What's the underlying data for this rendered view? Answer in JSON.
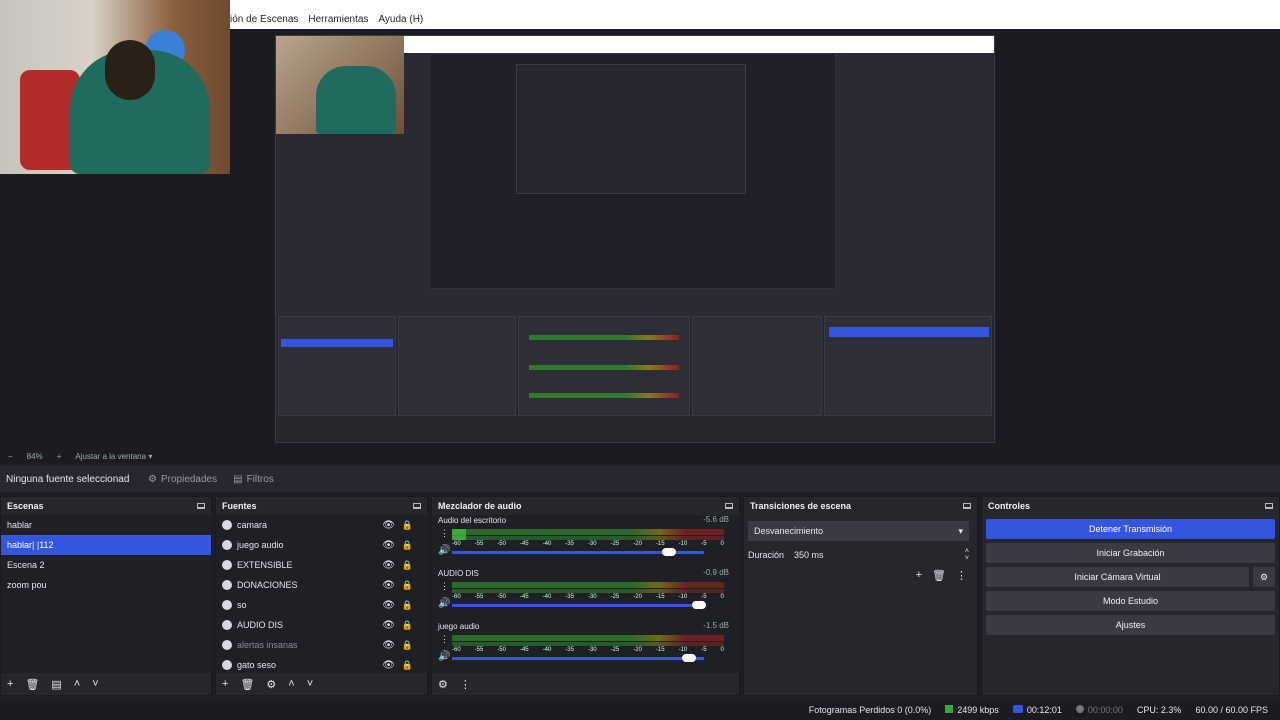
{
  "menu": {
    "item1": "ión de Escenas",
    "item2": "Herramientas",
    "item3": "Ayuda (H)"
  },
  "zoom": {
    "minus": "−",
    "value": "84%",
    "plus": "+",
    "fit": "Ajustar a la ventana"
  },
  "source_bar": {
    "none_selected": "Ninguna fuente seleccionad",
    "properties": "Propiedades",
    "filters": "Filtros"
  },
  "scenes": {
    "title": "Escenas",
    "items": [
      {
        "label": "hablar"
      },
      {
        "label": "hablar| |112"
      },
      {
        "label": "Escena 2"
      },
      {
        "label": "zoom pou"
      }
    ],
    "selected_index": 1
  },
  "sources": {
    "title": "Fuentes",
    "items": [
      {
        "label": "camara",
        "icon": "camera-icon"
      },
      {
        "label": "juego audio",
        "icon": "audio-icon"
      },
      {
        "label": "EXTENSIBLE",
        "icon": "browser-icon"
      },
      {
        "label": "DONACIONES",
        "icon": "browser-icon"
      },
      {
        "label": "so",
        "icon": "browser-icon"
      },
      {
        "label": "AUDIO DIS",
        "icon": "audio-icon"
      },
      {
        "label": "alertas insanas",
        "icon": "browser-icon"
      },
      {
        "label": "gato seso",
        "icon": "browser-icon"
      }
    ]
  },
  "mixer": {
    "title": "Mezclador de audio",
    "ticks": [
      "-60",
      "-55",
      "-50",
      "-45",
      "-40",
      "-35",
      "-30",
      "-25",
      "-20",
      "-15",
      "-10",
      "-5",
      "0"
    ],
    "channels": [
      {
        "name": "Audio del escritorio",
        "db": "-5.6 dB",
        "level": 0.05,
        "volume": 0.86
      },
      {
        "name": "AUDIO DIS",
        "db": "-0.9 dB",
        "level": 0.0,
        "volume": 0.98
      },
      {
        "name": "juego audio",
        "db": "-1.5 dB",
        "level": 0.0,
        "volume": 0.94
      }
    ]
  },
  "transitions": {
    "title": "Transiciones de escena",
    "selected": "Desvanecimiento",
    "duration_label": "Duración",
    "duration_value": "350 ms"
  },
  "controls": {
    "title": "Controles",
    "stop_stream": "Detener Transmisión",
    "start_recording": "Iniciar Grabación",
    "start_virtual_cam": "Iniciar Cámara Virtual",
    "studio_mode": "Modo Estudio",
    "settings": "Ajustes"
  },
  "status": {
    "dropped_frames": "Fotogramas Perdidos 0 (0.0%)",
    "bitrate": "2499 kbps",
    "stream_time": "00:12:01",
    "rec_time": "00:00:00",
    "cpu": "CPU: 2.3%",
    "fps": "60.00 / 60.00 FPS"
  },
  "colors": {
    "accent": "#3355e0",
    "panel": "#26262d",
    "background": "#1b1b21"
  }
}
